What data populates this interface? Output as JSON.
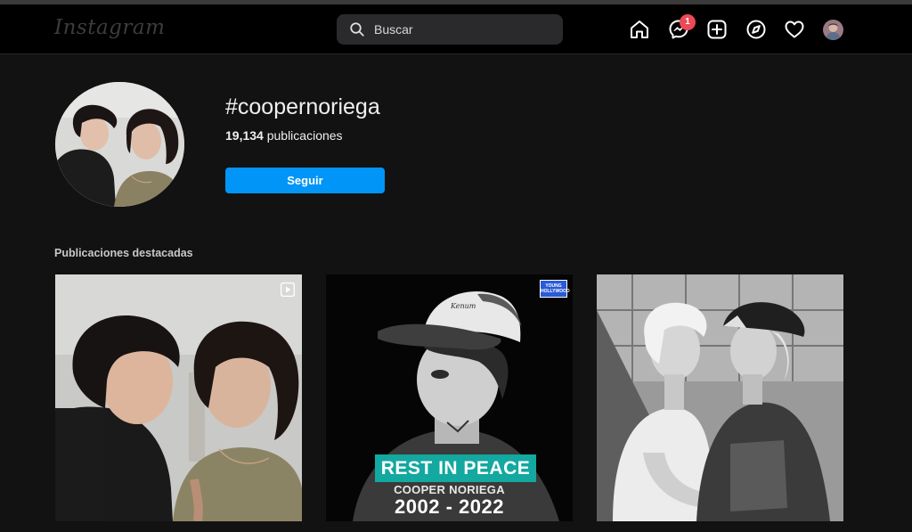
{
  "header": {
    "logo": "Instagram",
    "search_placeholder": "Buscar",
    "messenger_badge": "1"
  },
  "icons": [
    "home-icon",
    "messenger-icon",
    "new-post-icon",
    "explore-icon",
    "activity-heart-icon",
    "profile-avatar"
  ],
  "hashtag": {
    "name": "#coopernoriega",
    "count": "19,134",
    "count_label": " publicaciones",
    "follow_label": "Seguir"
  },
  "featured": {
    "title": "Publicaciones destacadas",
    "posts": [
      {
        "type": "video"
      },
      {
        "type": "image",
        "brand": "YOUNG HOLLYWOOD",
        "headline": "REST IN PEACE",
        "name": "COOPER NORIEGA",
        "years": "2002 - 2022"
      },
      {
        "type": "image"
      }
    ]
  },
  "colors": {
    "background": "#121212",
    "navbar": "#000000",
    "accent": "#0095f6",
    "badge": "#ed4956",
    "rip_banner": "#13a8a0"
  }
}
